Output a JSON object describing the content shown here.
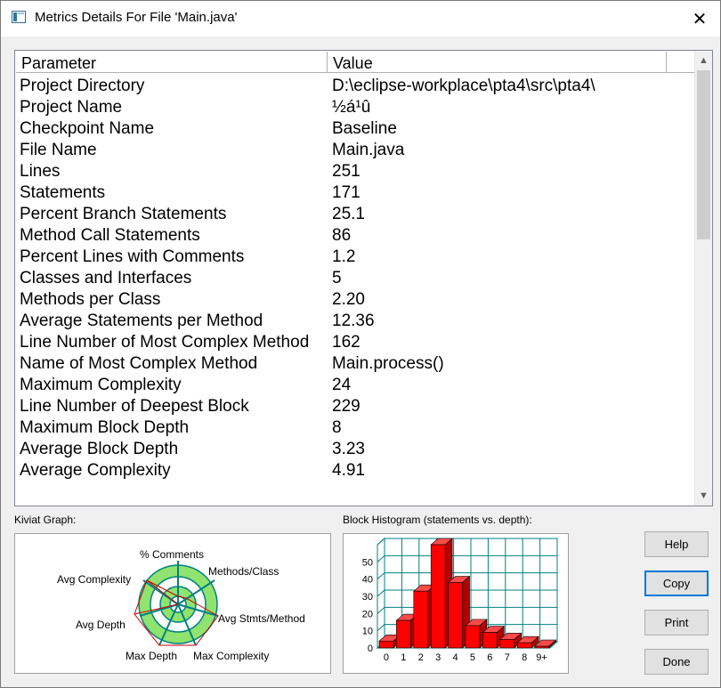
{
  "window": {
    "title": "Metrics Details For File 'Main.java'"
  },
  "table": {
    "headers": {
      "parameter": "Parameter",
      "value": "Value"
    },
    "rows": [
      {
        "parameter": "Project Directory",
        "value": "D:\\eclipse-workplace\\pta4\\src\\pta4\\"
      },
      {
        "parameter": "Project Name",
        "value": "½á¹û"
      },
      {
        "parameter": "Checkpoint Name",
        "value": "Baseline"
      },
      {
        "parameter": "File Name",
        "value": "Main.java"
      },
      {
        "parameter": "Lines",
        "value": "251"
      },
      {
        "parameter": "Statements",
        "value": "171"
      },
      {
        "parameter": "Percent Branch Statements",
        "value": "25.1"
      },
      {
        "parameter": "Method Call Statements",
        "value": "86"
      },
      {
        "parameter": "Percent Lines with Comments",
        "value": "1.2"
      },
      {
        "parameter": "Classes and Interfaces",
        "value": "5"
      },
      {
        "parameter": "Methods per Class",
        "value": "2.20"
      },
      {
        "parameter": "Average Statements per Method",
        "value": "12.36"
      },
      {
        "parameter": "Line Number of Most Complex Method",
        "value": "162"
      },
      {
        "parameter": "Name of Most Complex Method",
        "value": "Main.process()"
      },
      {
        "parameter": "Maximum Complexity",
        "value": "24"
      },
      {
        "parameter": "Line Number of Deepest Block",
        "value": "229"
      },
      {
        "parameter": "Maximum Block Depth",
        "value": "8"
      },
      {
        "parameter": "Average Block Depth",
        "value": "3.23"
      },
      {
        "parameter": "Average Complexity",
        "value": "4.91"
      }
    ]
  },
  "kiviat": {
    "label": "Kiviat Graph:",
    "axes": [
      "% Comments",
      "Methods/Class",
      "Avg Stmts/Method",
      "Max Complexity",
      "Max Depth",
      "Avg Depth",
      "Avg Complexity"
    ]
  },
  "histogram": {
    "label": "Block Histogram (statements vs. depth):",
    "y_ticks": [
      "0",
      "10",
      "20",
      "30",
      "40",
      "50"
    ],
    "x_labels": [
      "0",
      "1",
      "2",
      "3",
      "4",
      "5",
      "6",
      "7",
      "8",
      "9+"
    ],
    "values": [
      4,
      16,
      33,
      60,
      38,
      13,
      9,
      5,
      3,
      1
    ],
    "ylim": [
      0,
      60
    ],
    "bar_color": "#ff0000",
    "grid_color": "#008080"
  },
  "buttons": {
    "help": "Help",
    "copy": "Copy",
    "print": "Print",
    "done": "Done"
  }
}
